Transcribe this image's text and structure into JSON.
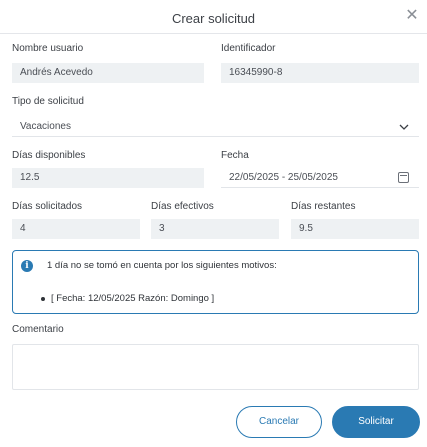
{
  "dialog": {
    "title": "Crear solicitud",
    "close_icon": "close-icon"
  },
  "form": {
    "user_name": {
      "label": "Nombre usuario",
      "value": "Andrés Acevedo"
    },
    "identifier": {
      "label": "Identificador",
      "value": "16345990-8"
    },
    "request_type": {
      "label": "Tipo de solicitud",
      "value": "Vacaciones",
      "icon": "chevron-down-icon"
    },
    "available_days": {
      "label": "Días disponibles",
      "value": "12.5"
    },
    "date": {
      "label": "Fecha",
      "value": "22/05/2025 - 25/05/2025",
      "icon": "calendar-icon"
    },
    "requested_days": {
      "label": "Días solicitados",
      "value": "4"
    },
    "effective_days": {
      "label": "Días efectivos",
      "value": "3"
    },
    "remaining_days": {
      "label": "Días restantes",
      "value": "9.5"
    },
    "comment": {
      "label": "Comentario",
      "value": ""
    }
  },
  "info": {
    "icon": "info-icon",
    "message": "1 día no se tomó en cuenta por los siguientes motivos:",
    "reasons": [
      "[ Fecha: 12/05/2025 Razón: Domingo ]"
    ]
  },
  "actions": {
    "cancel_label": "Cancelar",
    "submit_label": "Solicitar"
  },
  "colors": {
    "accent": "#2a7ab3",
    "field_bg": "#eef1f3"
  }
}
